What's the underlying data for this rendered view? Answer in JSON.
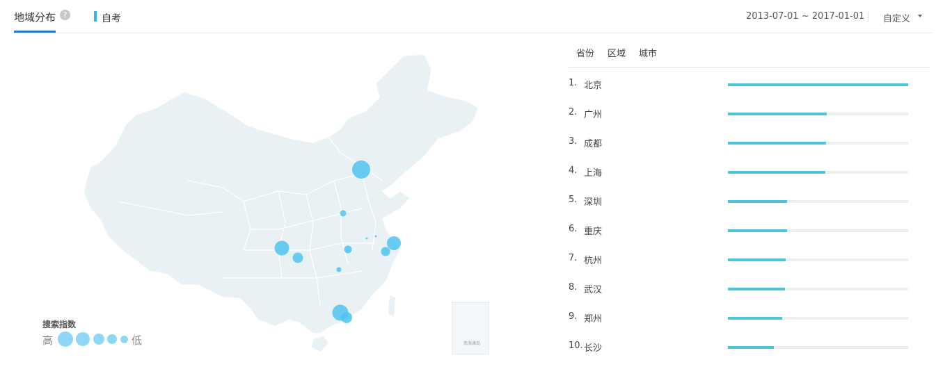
{
  "header": {
    "tab_label": "地域分布",
    "help_icon": "?",
    "keyword": "自考",
    "date_range": "2013-07-01 ~ 2017-01-01",
    "period_label": "自定义"
  },
  "map": {
    "inset_label": "南海诸岛",
    "legend": {
      "title": "搜索指数",
      "high": "高",
      "low": "低"
    },
    "bubble_color": "#4fc3f0"
  },
  "subtabs": [
    "省份",
    "区域",
    "城市"
  ],
  "ranking": [
    {
      "rank": "1.",
      "city": "北京",
      "value": 1.0
    },
    {
      "rank": "2.",
      "city": "广州",
      "value": 0.55
    },
    {
      "rank": "3.",
      "city": "成都",
      "value": 0.545
    },
    {
      "rank": "4.",
      "city": "上海",
      "value": 0.54
    },
    {
      "rank": "5.",
      "city": "深圳",
      "value": 0.33
    },
    {
      "rank": "6.",
      "city": "重庆",
      "value": 0.33
    },
    {
      "rank": "7.",
      "city": "杭州",
      "value": 0.32
    },
    {
      "rank": "8.",
      "city": "武汉",
      "value": 0.315
    },
    {
      "rank": "9.",
      "city": "郑州",
      "value": 0.3
    },
    {
      "rank": "10.",
      "city": "长沙",
      "value": 0.255
    }
  ]
}
